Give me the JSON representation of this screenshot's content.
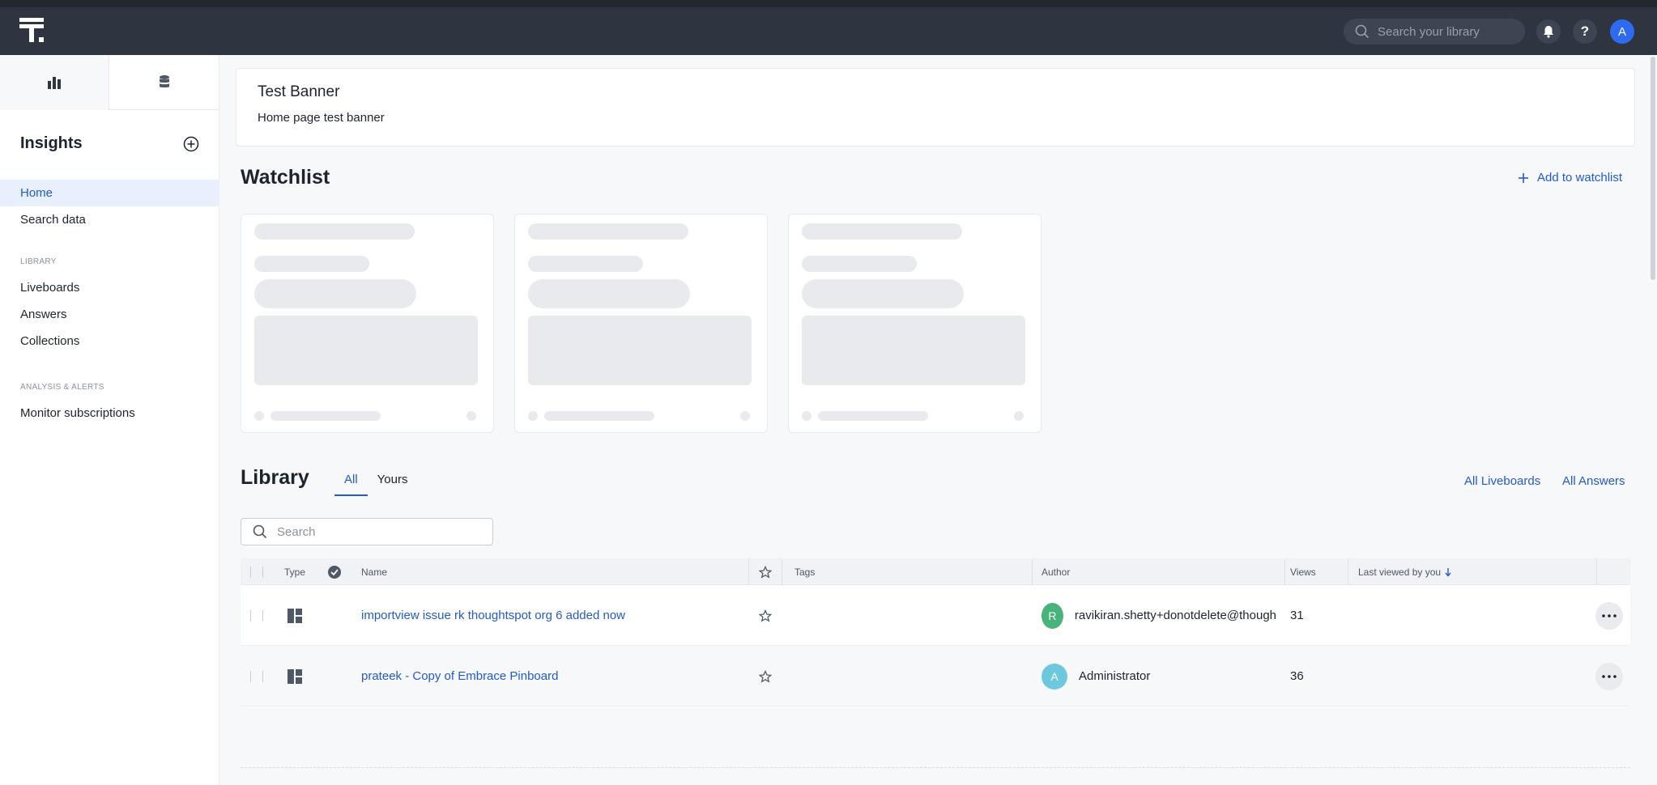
{
  "topbar": {
    "search_placeholder": "Search your library",
    "avatar_initial": "A",
    "help_label": "?"
  },
  "sidebar": {
    "title": "Insights",
    "items": [
      {
        "label": "Home",
        "active": true
      },
      {
        "label": "Search data"
      }
    ],
    "library_section": "LIBRARY",
    "library_items": [
      {
        "label": "Liveboards"
      },
      {
        "label": "Answers"
      },
      {
        "label": "Collections"
      }
    ],
    "analysis_section": "ANALYSIS & ALERTS",
    "analysis_items": [
      {
        "label": "Monitor subscriptions"
      }
    ]
  },
  "banner": {
    "title": "Test Banner",
    "text": "Home page test banner"
  },
  "watchlist": {
    "title": "Watchlist",
    "add_label": "Add to watchlist"
  },
  "library": {
    "title": "Library",
    "tabs": [
      "All",
      "Yours"
    ],
    "active_tab": "All",
    "all_liveboards": "All Liveboards",
    "all_answers": "All Answers",
    "search_placeholder": "Search",
    "columns": {
      "type": "Type",
      "name": "Name",
      "tags": "Tags",
      "author": "Author",
      "views": "Views",
      "last_viewed": "Last viewed by you"
    },
    "rows": [
      {
        "name": "importview issue rk thoughtspot org 6 added now",
        "author_initial": "R",
        "author": "ravikiran.shetty+donotdelete@though",
        "views": "31",
        "author_color": "#48b37a"
      },
      {
        "name": "prateek - Copy of Embrace Pinboard",
        "author_initial": "A",
        "author": "Administrator",
        "views": "36",
        "author_color": "#6ec8dd"
      }
    ]
  },
  "colors": {
    "accent": "#2359d1",
    "topbar": "#2e3541"
  }
}
